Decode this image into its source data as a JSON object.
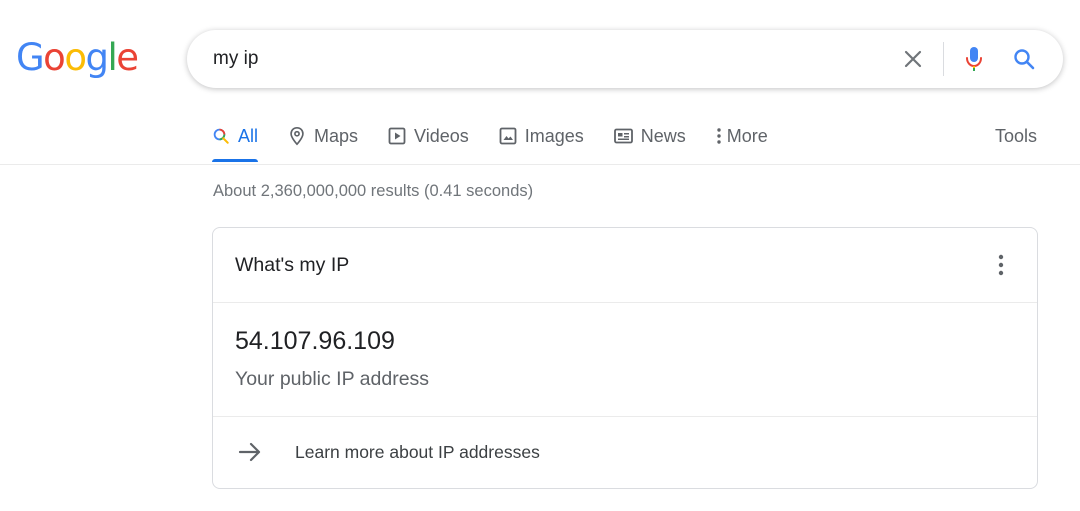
{
  "logo": {
    "letters": [
      "G",
      "o",
      "o",
      "g",
      "l",
      "e"
    ],
    "colors": [
      "#4285F4",
      "#EA4335",
      "#FBBC05",
      "#4285F4",
      "#34A853",
      "#EA4335"
    ]
  },
  "search": {
    "query": "my ip",
    "clear_icon": "close-icon",
    "mic_icon": "microphone-icon",
    "search_icon": "search-icon"
  },
  "tabs": [
    {
      "label": "All",
      "icon": "search-icon",
      "active": true
    },
    {
      "label": "Maps",
      "icon": "map-pin-icon",
      "active": false
    },
    {
      "label": "Videos",
      "icon": "play-icon",
      "active": false
    },
    {
      "label": "Images",
      "icon": "image-icon",
      "active": false
    },
    {
      "label": "News",
      "icon": "news-icon",
      "active": false
    },
    {
      "label": "More",
      "icon": "more-vertical-icon",
      "active": false
    }
  ],
  "tools_label": "Tools",
  "result_stats": "About 2,360,000,000 results (0.41 seconds)",
  "card": {
    "title": "What's my IP",
    "ip": "54.107.96.109",
    "ip_label": "Your public IP address",
    "learn_more": "Learn more about IP addresses"
  },
  "colors": {
    "accent": "#1a73e8",
    "text": "#202124",
    "muted": "#5f6368"
  }
}
